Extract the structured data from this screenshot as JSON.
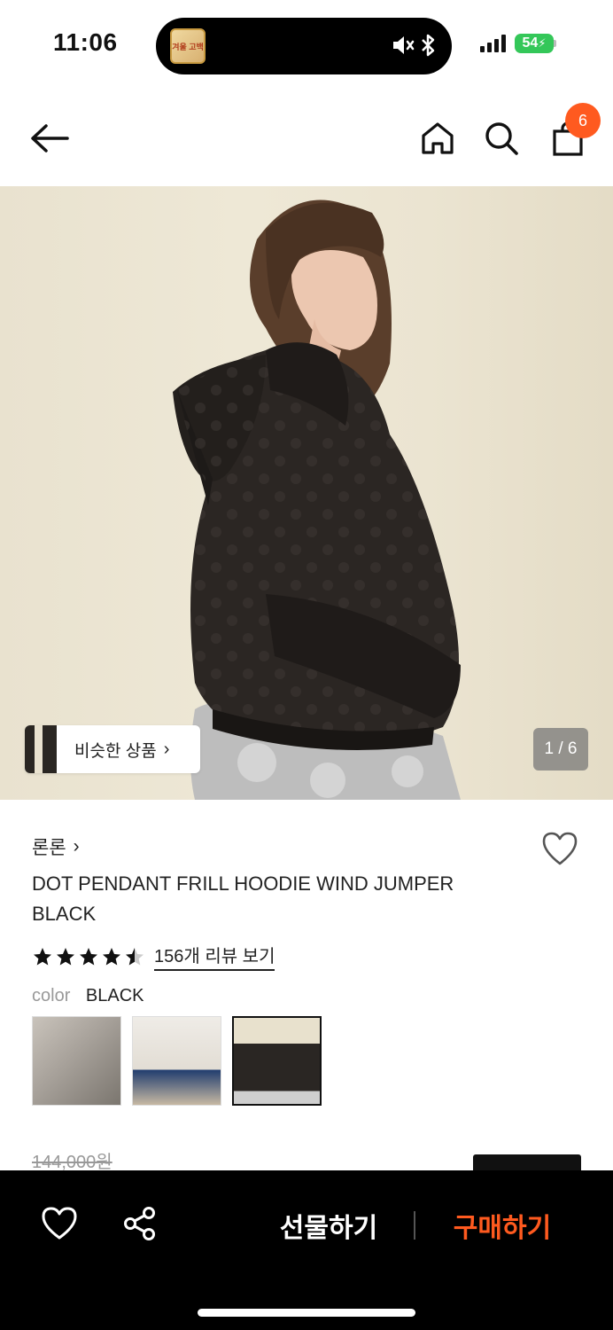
{
  "status_bar": {
    "time": "11:06",
    "island_thumb_text": "겨울 고백",
    "battery": "54"
  },
  "nav": {
    "back_icon": "arrow-left-icon",
    "home_icon": "home-icon",
    "search_icon": "search-icon",
    "cart_icon": "shopping-bag-icon",
    "cart_badge": "6",
    "badge_color": "#ff5a1f"
  },
  "hero": {
    "similar_label": "비슷한 상품",
    "similar_chevron": "›",
    "counter": "1 / 6"
  },
  "product": {
    "brand": "론론",
    "brand_chevron": "›",
    "title": "DOT PENDANT FRILL HOODIE WIND JUMPER BLACK",
    "rating": 4.5,
    "review_link": "156개 리뷰 보기",
    "color_key": "color",
    "color_value": "BLACK",
    "swatches": [
      {
        "name": "gray hoodie"
      },
      {
        "name": "white hoodie"
      },
      {
        "name": "black dot jumper",
        "selected": true
      }
    ],
    "original_price": "144,000원"
  },
  "bottom_bar": {
    "wishlist_icon": "heart-icon",
    "share_icon": "share-icon",
    "gift_label": "선물하기",
    "buy_label": "구매하기",
    "buy_color": "#ff5a1f"
  }
}
